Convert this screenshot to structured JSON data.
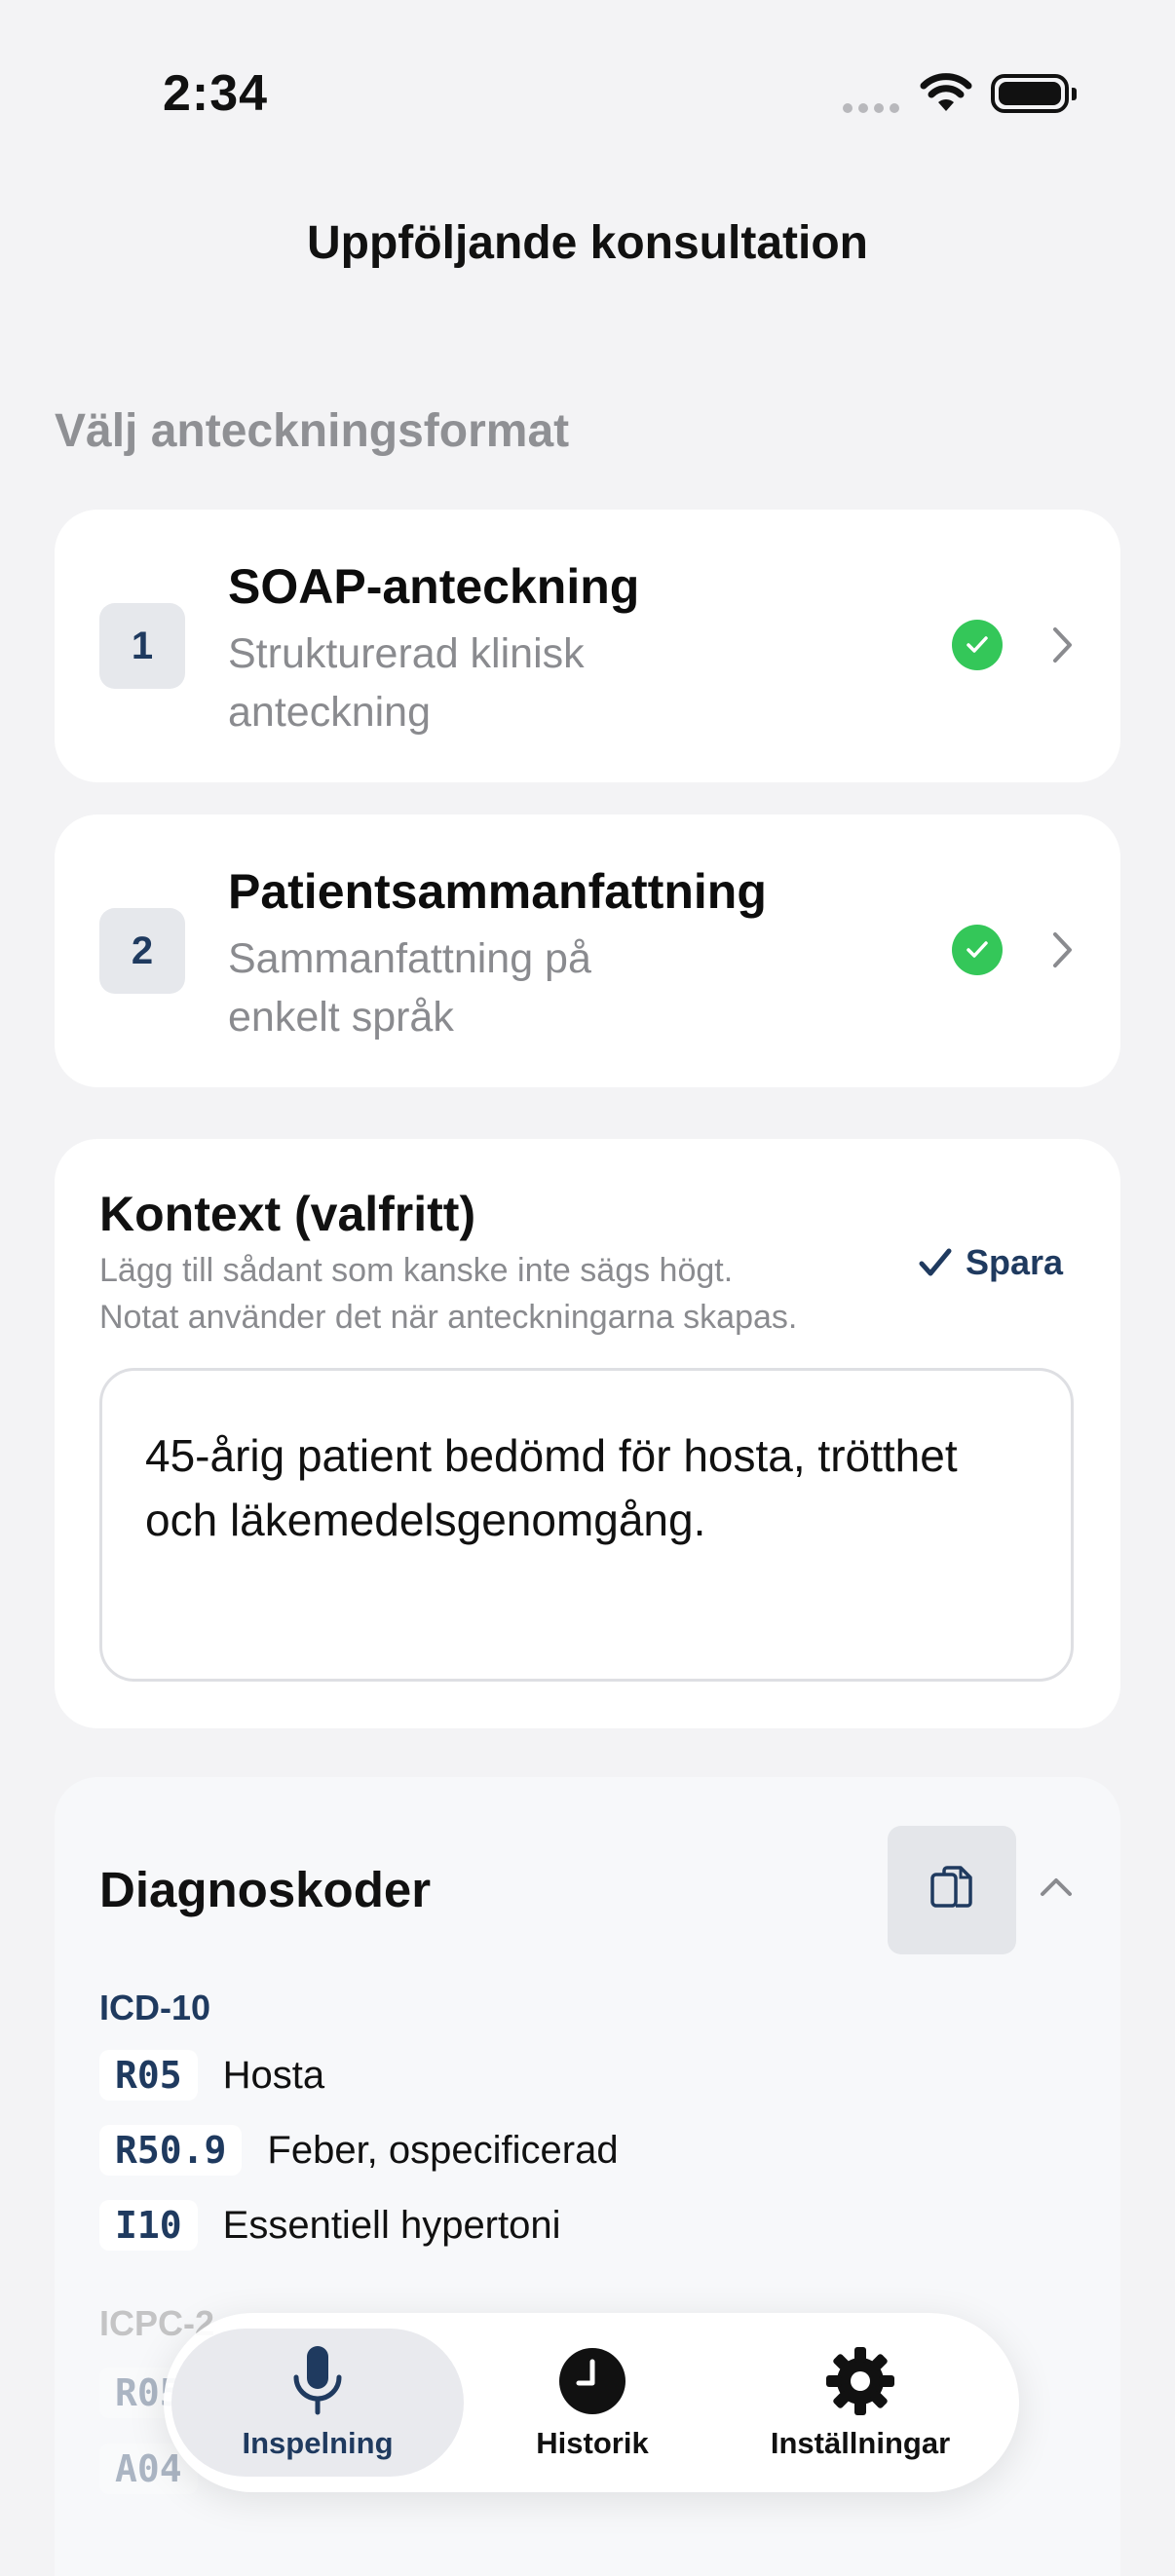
{
  "status_bar": {
    "time": "2:34"
  },
  "header": {
    "title": "Uppföljande konsultation"
  },
  "format_section": {
    "label": "Välj anteckningsformat",
    "items": [
      {
        "number": "1",
        "title": "SOAP-anteckning",
        "subtitle": "Strukturerad klinisk anteckning",
        "selected": true
      },
      {
        "number": "2",
        "title": "Patientsammanfattning",
        "subtitle": "Sammanfattning på enkelt språk",
        "selected": true
      }
    ]
  },
  "context": {
    "title": "Kontext (valfritt)",
    "description_line1": "Lägg till sådant som kanske inte sägs högt.",
    "description_line2": "Notat använder det när anteckningarna skapas.",
    "save_label": "Spara",
    "text": "45-årig patient bedömd för hosta, trötthet och läkemedelsgenomgång."
  },
  "diagnosis": {
    "title": "Diagnoskoder",
    "icd10": {
      "label": "ICD-10",
      "codes": [
        {
          "code": "R05",
          "description": "Hosta"
        },
        {
          "code": "R50.9",
          "description": "Feber, ospecificerad"
        },
        {
          "code": "I10",
          "description": "Essentiell hypertoni"
        }
      ]
    },
    "icpc2": {
      "label": "ICPC-2",
      "codes": [
        {
          "code": "R05",
          "description": ""
        },
        {
          "code": "A04",
          "description": ""
        }
      ]
    }
  },
  "tabbar": {
    "tabs": [
      {
        "label": "Inspelning",
        "icon": "microphone-icon",
        "active": true
      },
      {
        "label": "Historik",
        "icon": "clock-icon",
        "active": false
      },
      {
        "label": "Inställningar",
        "icon": "gear-icon",
        "active": false
      }
    ]
  },
  "colors": {
    "accent": "#1f3a5f",
    "success": "#34c759",
    "background": "#f3f3f5"
  }
}
